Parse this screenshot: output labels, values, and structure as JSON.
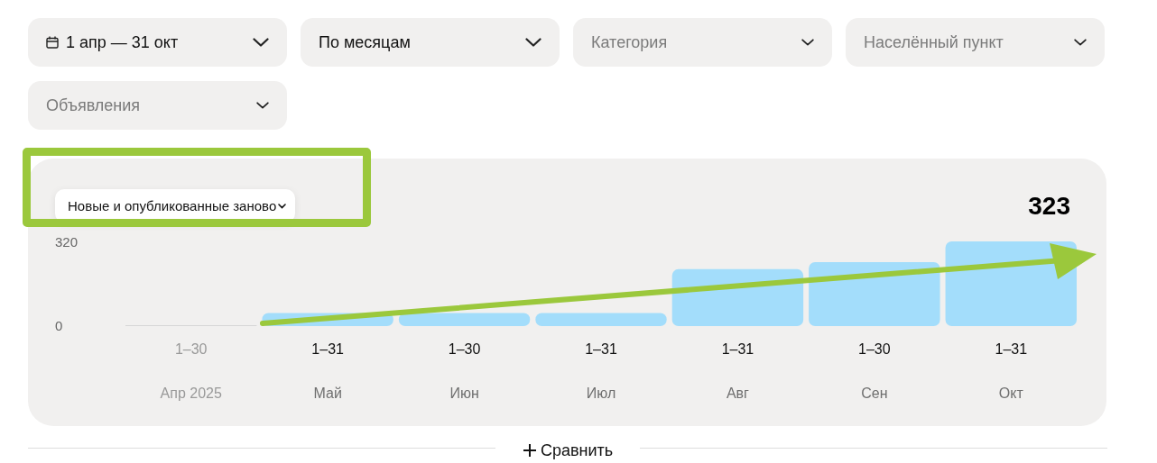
{
  "filters": [
    {
      "kind": "date",
      "value": "1 апр — 31 окт"
    },
    {
      "kind": "select",
      "value": "По месяцам"
    },
    {
      "kind": "select",
      "placeholder": "Категория"
    },
    {
      "kind": "select",
      "placeholder": "Населённый пункт"
    },
    {
      "kind": "select",
      "placeholder": "Объявления"
    }
  ],
  "chart_panel": {
    "total": "323",
    "ranges": [
      {
        "text": "1–30",
        "dimmed": true
      },
      {
        "text": "1–31",
        "dimmed": false
      },
      {
        "text": "1–30",
        "dimmed": false
      },
      {
        "text": "1–31",
        "dimmed": false
      },
      {
        "text": "1–31",
        "dimmed": false
      },
      {
        "text": "1–30",
        "dimmed": false
      },
      {
        "text": "1–31",
        "dimmed": false
      }
    ],
    "chart_data": {
      "type": "bar",
      "categories": [
        "Апр 2025",
        "Май",
        "Июн",
        "Июл",
        "Авг",
        "Сен",
        "Окт"
      ],
      "series": [
        {
          "name": "Новые и опубликованные заново",
          "color": "#a3ddfb",
          "values": [
            0,
            50,
            50,
            50,
            217,
            244,
            323
          ]
        }
      ],
      "ylim": [
        0,
        323
      ],
      "yticks": [
        0,
        320
      ]
    }
  },
  "highlight_frame": true,
  "trend_arrow": true,
  "compare_button": "Сравнить"
}
